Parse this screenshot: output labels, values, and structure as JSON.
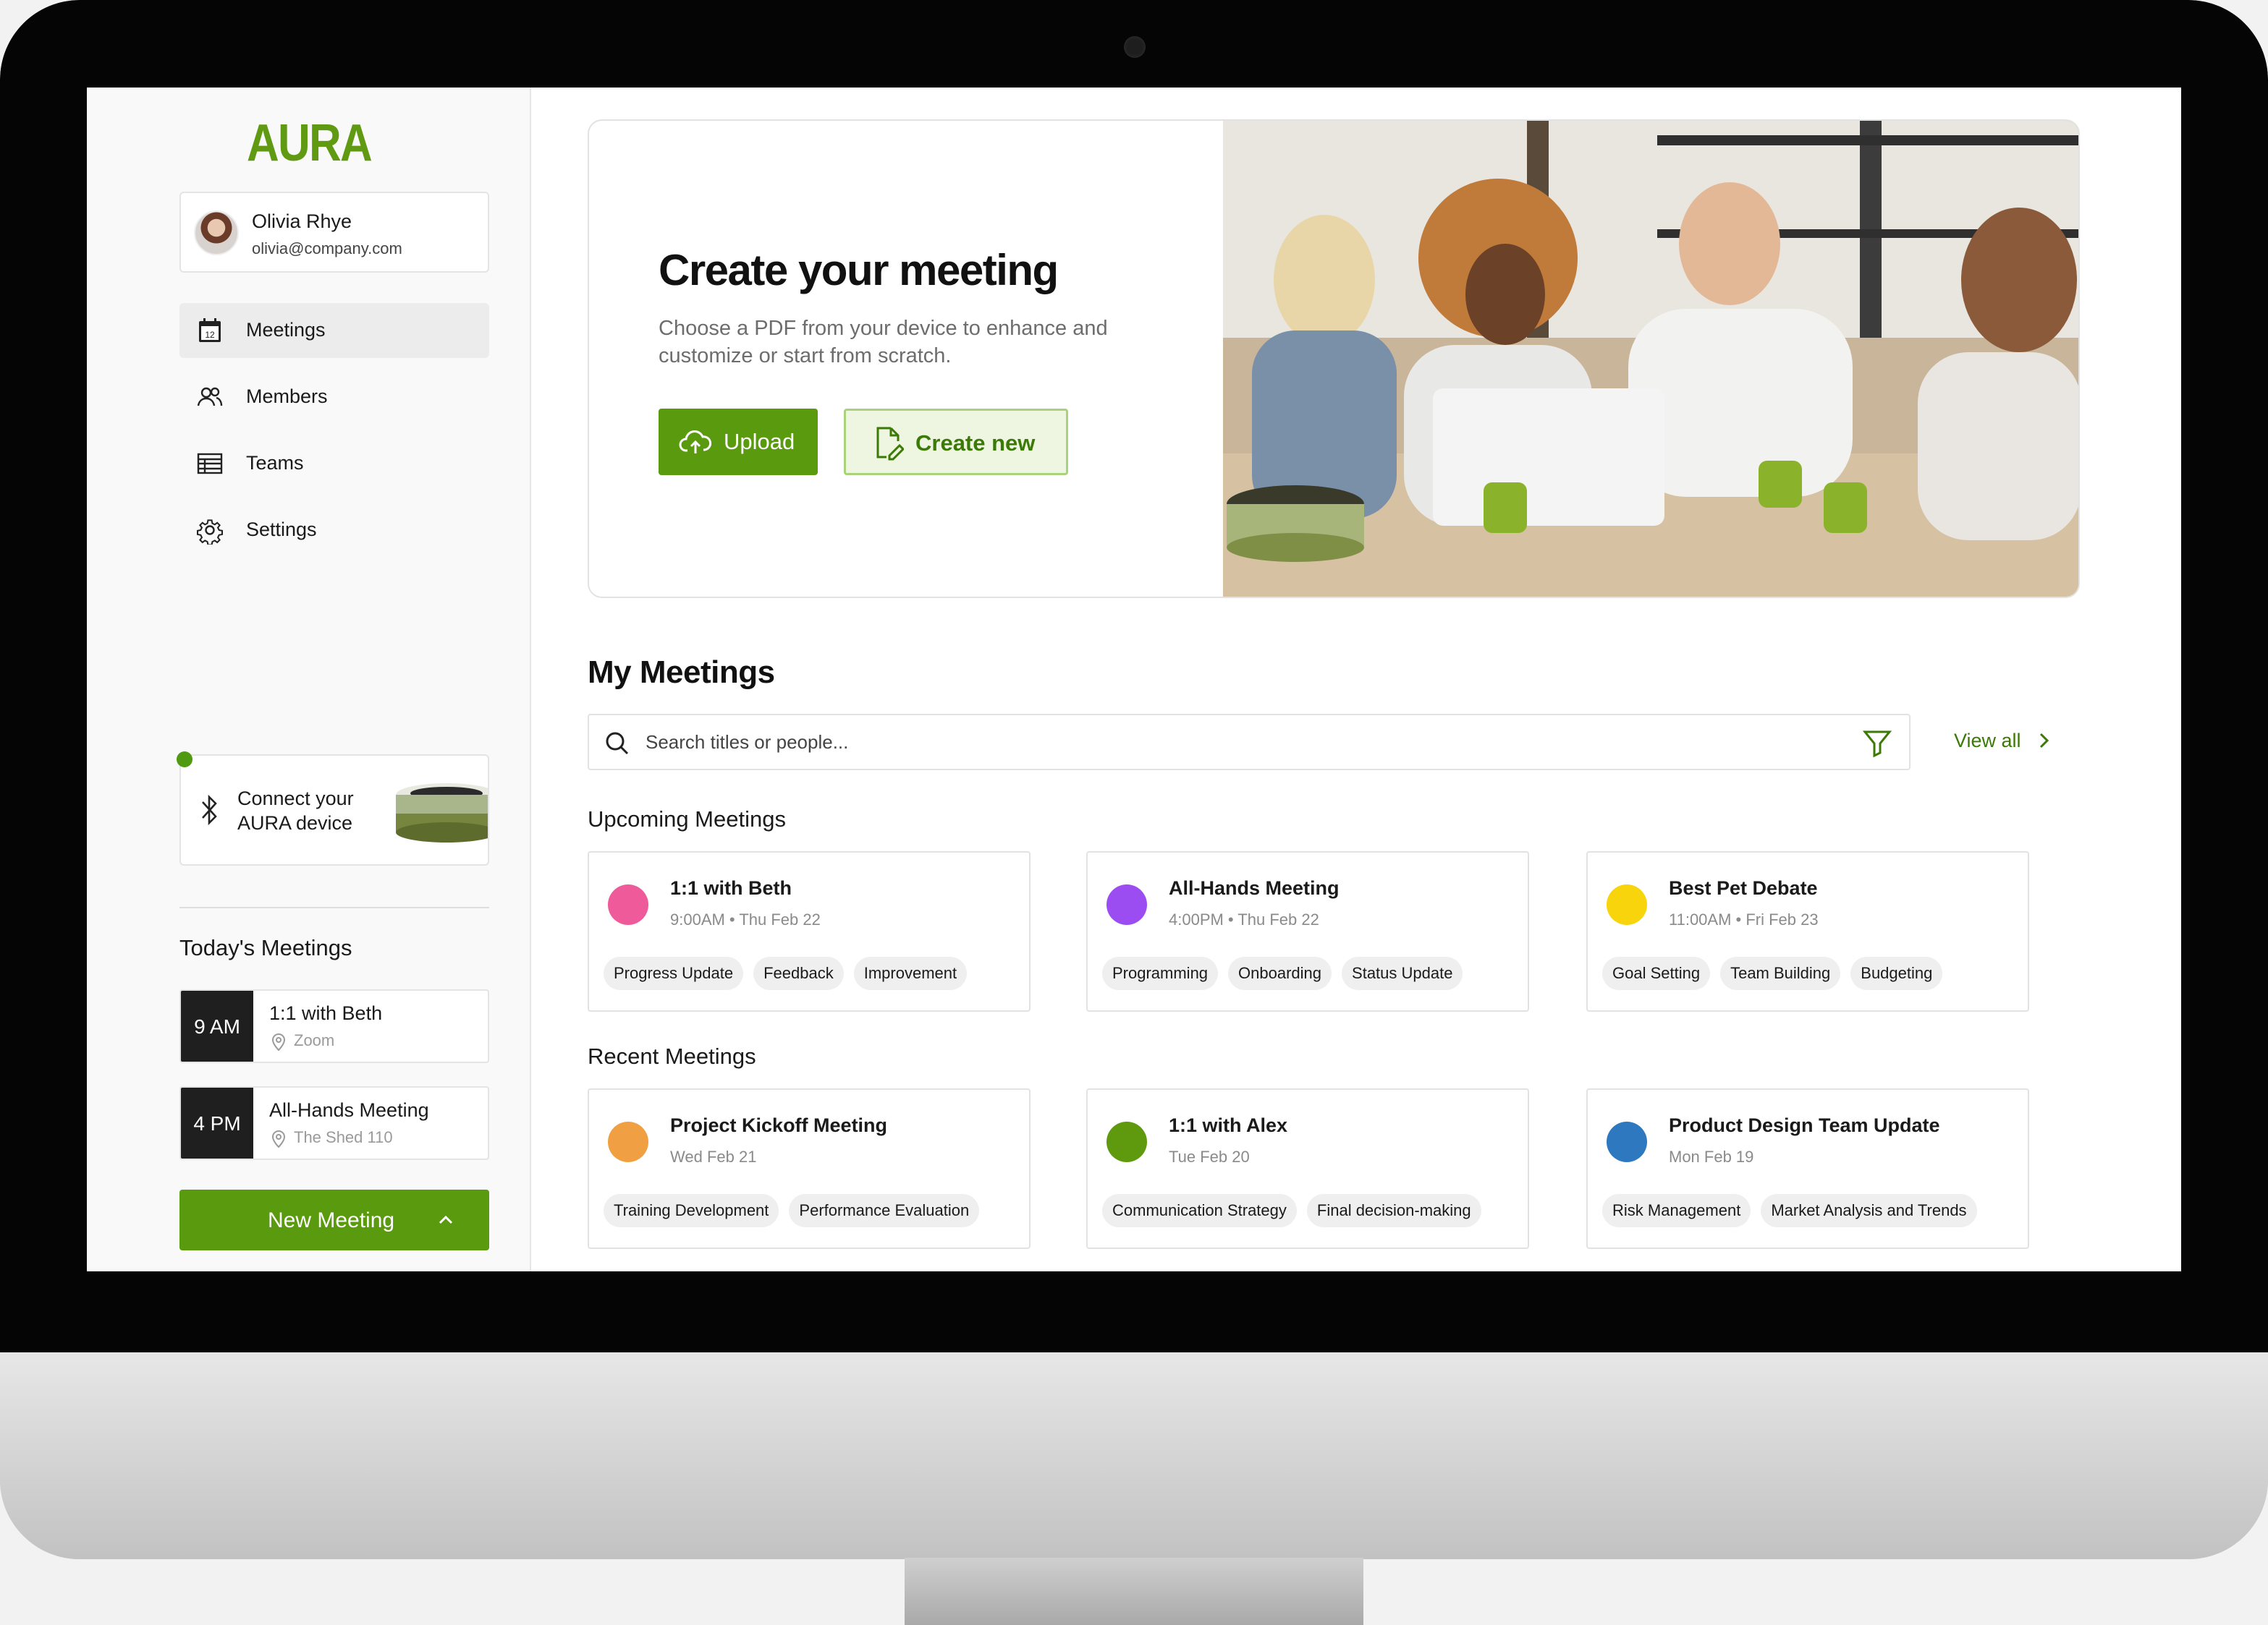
{
  "brand": {
    "logo": "AURA",
    "accent": "#5a9a0f"
  },
  "user": {
    "name": "Olivia Rhye",
    "email": "olivia@company.com"
  },
  "nav": [
    {
      "label": "Meetings",
      "icon": "calendar-icon",
      "active": true
    },
    {
      "label": "Members",
      "icon": "users-icon"
    },
    {
      "label": "Teams",
      "icon": "table-icon"
    },
    {
      "label": "Settings",
      "icon": "gear-icon"
    }
  ],
  "device": {
    "line1": "Connect your",
    "line2": "AURA device",
    "icon": "bluetooth-icon"
  },
  "today": {
    "title": "Today's Meetings",
    "items": [
      {
        "time": "9 AM",
        "name": "1:1 with Beth",
        "location": "Zoom"
      },
      {
        "time": "4 PM",
        "name": "All-Hands Meeting",
        "location": "The Shed 110"
      }
    ]
  },
  "new_meeting": {
    "label": "New Meeting"
  },
  "hero": {
    "title": "Create your meeting",
    "subtitle": "Choose a PDF from your device to enhance and customize or start from scratch.",
    "upload_label": "Upload",
    "create_label": "Create new"
  },
  "my_meetings": {
    "title": "My Meetings",
    "search_placeholder": "Search titles or people...",
    "view_all": "View all",
    "upcoming_title": "Upcoming Meetings",
    "recent_title": "Recent Meetings",
    "upcoming": [
      {
        "title": "1:1 with Beth",
        "meta": "9:00AM • Thu Feb 22",
        "color": "#ee5a9a",
        "tags": [
          "Progress Update",
          "Feedback",
          "Improvement"
        ]
      },
      {
        "title": "All-Hands Meeting",
        "meta": "4:00PM • Thu Feb 22",
        "color": "#9b4df2",
        "tags": [
          "Programming",
          "Onboarding",
          "Status Update"
        ]
      },
      {
        "title": "Best Pet Debate",
        "meta": "11:00AM • Fri Feb 23",
        "color": "#f8d40c",
        "tags": [
          "Goal Setting",
          "Team Building",
          "Budgeting"
        ]
      }
    ],
    "recent": [
      {
        "title": "Project Kickoff Meeting",
        "meta": "Wed Feb 21",
        "color": "#f0a043",
        "tags": [
          "Training Development",
          "Performance Evaluation"
        ]
      },
      {
        "title": "1:1 with Alex",
        "meta": "Tue Feb 20",
        "color": "#5f9a0e",
        "tags": [
          "Communication Strategy",
          "Final decision-making"
        ]
      },
      {
        "title": "Product Design Team Update",
        "meta": "Mon Feb 19",
        "color": "#2e78c0",
        "tags": [
          "Risk Management",
          "Market Analysis and Trends"
        ]
      }
    ]
  }
}
